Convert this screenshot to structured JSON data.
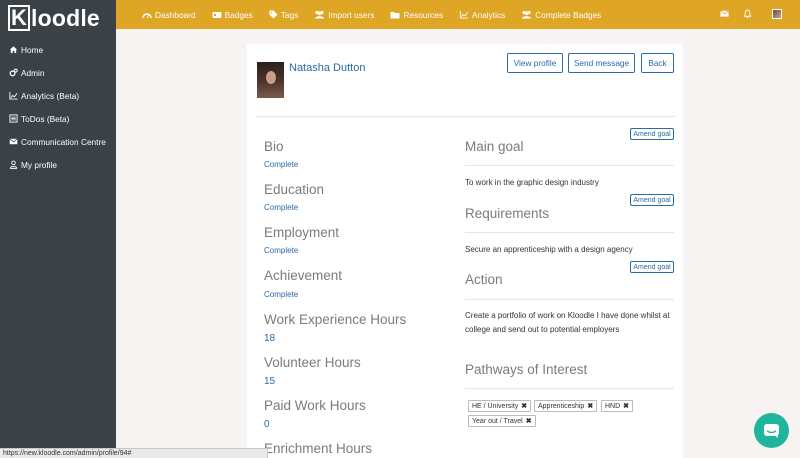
{
  "brand": {
    "logo_k": "K",
    "logo_rest": "loodle"
  },
  "sidebar": {
    "items": [
      {
        "label": "Home",
        "icon": "home-icon"
      },
      {
        "label": "Admin",
        "icon": "cogs-icon"
      },
      {
        "label": "Analytics (Beta)",
        "icon": "line-chart-icon"
      },
      {
        "label": "ToDos (Beta)",
        "icon": "list-icon"
      },
      {
        "label": "Communication Centre",
        "icon": "envelope-icon"
      },
      {
        "label": "My profile",
        "icon": "user-icon"
      }
    ]
  },
  "topnav": {
    "items": [
      {
        "label": "Dashboard",
        "icon": "dashboard-icon"
      },
      {
        "label": "Badges",
        "icon": "badges-icon"
      },
      {
        "label": "Tags",
        "icon": "tags-icon"
      },
      {
        "label": "Import users",
        "icon": "users-icon"
      },
      {
        "label": "Resources",
        "icon": "folder-icon"
      },
      {
        "label": "Analytics",
        "icon": "line-chart-icon"
      },
      {
        "label": "Complete Badges",
        "icon": "users-icon"
      }
    ]
  },
  "profile": {
    "name": "Natasha Dutton",
    "buttons": {
      "view": "View profile",
      "message": "Send message",
      "back": "Back"
    }
  },
  "left": {
    "bio": {
      "title": "Bio",
      "status": "Complete"
    },
    "education": {
      "title": "Education",
      "status": "Complete"
    },
    "employment": {
      "title": "Employment",
      "status": "Complete"
    },
    "achievement": {
      "title": "Achievement",
      "status": "Complete"
    },
    "work_hours": {
      "title": "Work Experience Hours",
      "value": "18"
    },
    "volunteer_hours": {
      "title": "Volunteer Hours",
      "value": "15"
    },
    "paid_hours": {
      "title": "Paid Work Hours",
      "value": "0"
    },
    "enrichment_hours": {
      "title": "Enrichment Hours"
    }
  },
  "right": {
    "amend_label": "Amend goal",
    "main_goal": {
      "title": "Main goal",
      "text": "To work in the graphic design industry"
    },
    "requirements": {
      "title": "Requirements",
      "text": "Secure an apprenticeship with a design agency"
    },
    "action": {
      "title": "Action",
      "text": "Create a portfolio of work on Kloodle I have done whilst at college and send out to potential employers"
    },
    "pathways": {
      "title": "Pathways of Interest",
      "tags": [
        "HE / University",
        "Apprenticeship",
        "HND",
        "Year out / Travel"
      ],
      "remove_glyph": "✖"
    }
  },
  "statusbar": {
    "url": "https://new.kloodle.com/admin/profile/94#"
  },
  "colors": {
    "topbar": "#dfa524",
    "sidebar": "#3a4147",
    "link": "#2a6aa5",
    "chat": "#1fb59c"
  }
}
